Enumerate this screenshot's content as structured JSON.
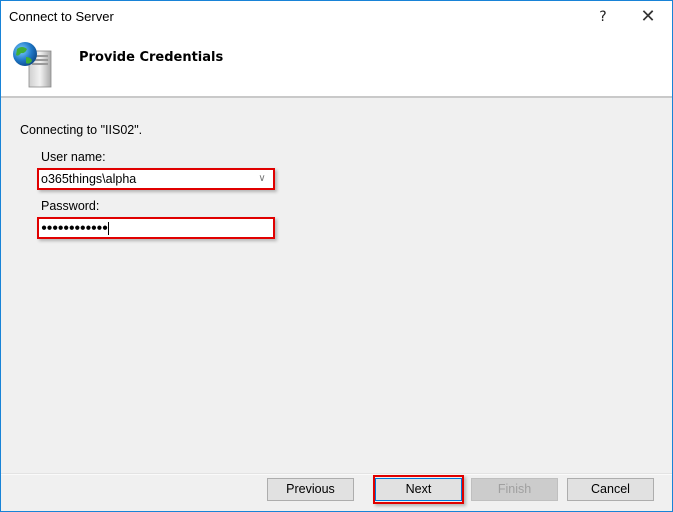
{
  "window": {
    "title": "Connect to Server",
    "help_glyph": "?",
    "close_glyph": "✕"
  },
  "header": {
    "title": "Provide Credentials",
    "icon": "server-globe-icon"
  },
  "form": {
    "connecting_text": "Connecting to \"IIS02\".",
    "username_label": "User name:",
    "username_value": "o365things\\alpha",
    "password_label": "Password:",
    "password_mask": "●●●●●●●●●●●●",
    "password_length": 12
  },
  "footer": {
    "previous_label": "Previous",
    "next_label": "Next",
    "finish_label": "Finish",
    "cancel_label": "Cancel"
  },
  "colors": {
    "highlight": "#e00000",
    "window_border": "#1883d7"
  }
}
